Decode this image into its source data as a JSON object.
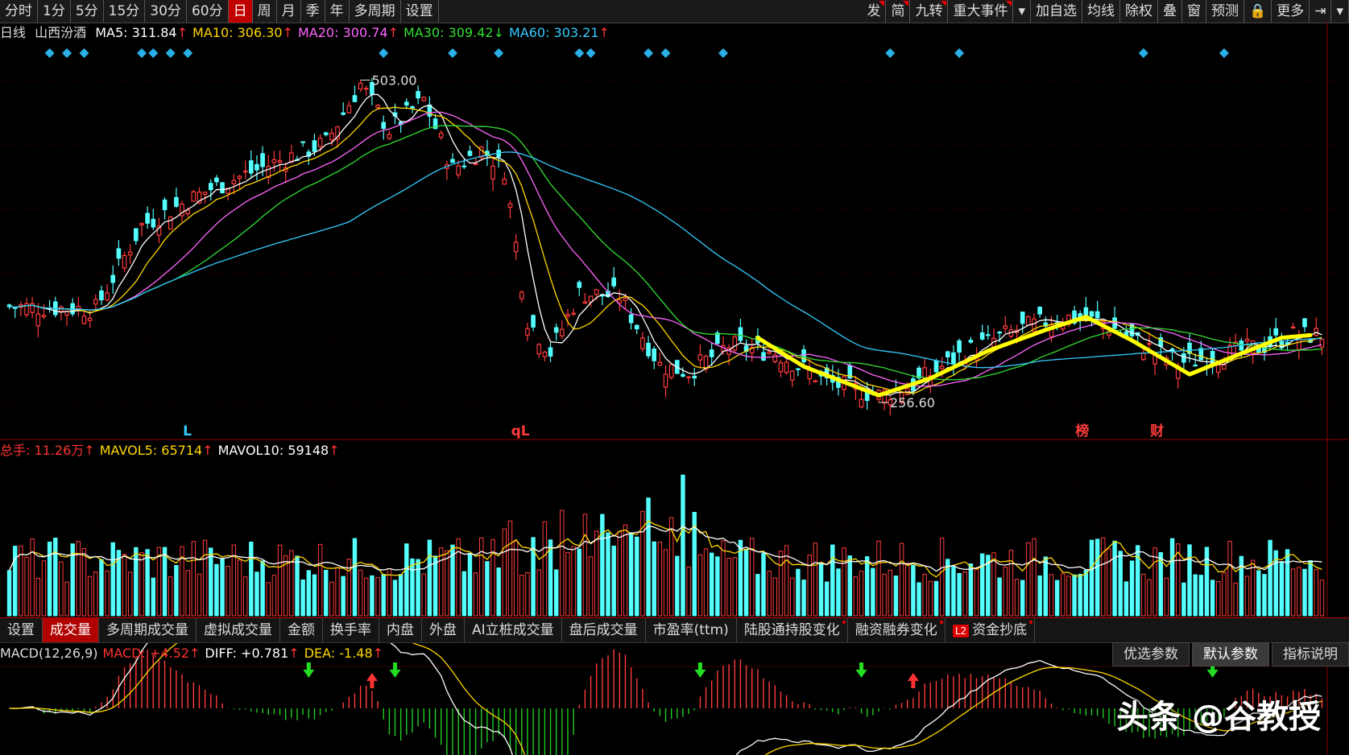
{
  "toolbar": {
    "left": [
      "分时",
      "1分",
      "5分",
      "15分",
      "30分",
      "60分",
      "日",
      "周",
      "月",
      "季",
      "年",
      "多周期",
      "设置"
    ],
    "active": "日",
    "right": [
      {
        "label": "发",
        "dot": true
      },
      {
        "label": "简",
        "dot": true
      },
      {
        "label": "九转",
        "dot": true
      },
      {
        "label": "重大事件",
        "dot": true
      },
      {
        "label": "▾",
        "dot": false
      },
      {
        "label": "加自选",
        "dot": false
      },
      {
        "label": "均线",
        "dot": false
      },
      {
        "label": "除权",
        "dot": false
      },
      {
        "label": "叠",
        "dot": false
      },
      {
        "label": "窗",
        "dot": false
      },
      {
        "label": "预测",
        "dot": false
      },
      {
        "label": "🔒",
        "dot": false
      },
      {
        "label": "更多",
        "dot": false
      },
      {
        "label": "⇥",
        "dot": false
      },
      {
        "label": "▾",
        "dot": false
      }
    ]
  },
  "ma_line": {
    "period": "日线",
    "stock": "山西汾酒",
    "items": [
      {
        "text": "MA5: 311.84",
        "arrow": "↑",
        "color": "#ffffff"
      },
      {
        "text": "MA10: 306.30",
        "arrow": "↑",
        "color": "#ffd700"
      },
      {
        "text": "MA20: 300.74",
        "arrow": "↑",
        "color": "#ff66ff"
      },
      {
        "text": "MA30: 309.42",
        "arrow": "↓",
        "color": "#33dd33"
      },
      {
        "text": "MA60: 303.21",
        "arrow": "↑",
        "color": "#33ccff"
      }
    ]
  },
  "vol_line": {
    "items": [
      {
        "text": "总手: 11.26万",
        "arrow": "↑",
        "color": "#ff3333"
      },
      {
        "text": "MAVOL5: 65714",
        "arrow": "↑",
        "color": "#ffd700"
      },
      {
        "text": "MAVOL10: 59148",
        "arrow": "↑",
        "color": "#ffffff"
      }
    ]
  },
  "macd_line": {
    "items": [
      {
        "text": "MACD(12,26,9)",
        "arrow": "",
        "color": "#dddddd"
      },
      {
        "text": "MACD: +4.52",
        "arrow": "↑",
        "color": "#ff3333"
      },
      {
        "text": "DIFF: +0.781",
        "arrow": "↑",
        "color": "#ffffff"
      },
      {
        "text": "DEA: -1.48",
        "arrow": "↑",
        "color": "#ffd700"
      }
    ]
  },
  "tabs": [
    {
      "label": "设置",
      "active": false,
      "dot": false
    },
    {
      "label": "成交量",
      "active": true,
      "dot": false
    },
    {
      "label": "多周期成交量",
      "active": false,
      "dot": false
    },
    {
      "label": "虚拟成交量",
      "active": false,
      "dot": false
    },
    {
      "label": "金额",
      "active": false,
      "dot": false
    },
    {
      "label": "换手率",
      "active": false,
      "dot": false
    },
    {
      "label": "内盘",
      "active": false,
      "dot": false
    },
    {
      "label": "外盘",
      "active": false,
      "dot": false
    },
    {
      "label": "AI立桩成交量",
      "active": false,
      "dot": false
    },
    {
      "label": "盘后成交量",
      "active": false,
      "dot": false
    },
    {
      "label": "市盈率(ttm)",
      "active": false,
      "dot": false
    },
    {
      "label": "陆股通持股变化",
      "active": false,
      "dot": true
    },
    {
      "label": "融资融券变化",
      "active": false,
      "dot": true
    },
    {
      "label": "资金抄底",
      "active": false,
      "dot": true,
      "badge": "L2"
    }
  ],
  "macd_buttons": [
    {
      "label": "优选参数",
      "active": false
    },
    {
      "label": "默认参数",
      "active": true
    },
    {
      "label": "指标说明",
      "active": false
    }
  ],
  "watermark": "头条 @谷教授",
  "colors": {
    "up": "#ff3b3b",
    "down": "#54ffff",
    "ma5": "#ffffff",
    "ma10": "#ffd700",
    "ma20": "#ff66ff",
    "ma30": "#33dd33",
    "ma60": "#33ccff",
    "hand": "#ffff00"
  },
  "chart_data": {
    "type": "candlestick",
    "price_range": [
      235,
      515
    ],
    "high_label": "503.00",
    "low_label": "256.60",
    "markers": [
      {
        "text": "L",
        "color": "#33ccff",
        "index": 31
      },
      {
        "text": "qL",
        "color": "#ff3b3b",
        "index": 88
      },
      {
        "text": "榜",
        "color": "#ff3b3b",
        "index": 186
      },
      {
        "text": "财",
        "color": "#ff3b3b",
        "index": 199
      }
    ],
    "key_points": [
      {
        "index": 0,
        "price": 330
      },
      {
        "index": 15,
        "price": 328
      },
      {
        "index": 23,
        "price": 392
      },
      {
        "index": 35,
        "price": 420
      },
      {
        "index": 45,
        "price": 438
      },
      {
        "index": 55,
        "price": 455
      },
      {
        "index": 61,
        "price": 500
      },
      {
        "index": 66,
        "price": 465
      },
      {
        "index": 72,
        "price": 488
      },
      {
        "index": 77,
        "price": 435
      },
      {
        "index": 82,
        "price": 450
      },
      {
        "index": 86,
        "price": 435
      },
      {
        "index": 90,
        "price": 320
      },
      {
        "index": 94,
        "price": 295
      },
      {
        "index": 99,
        "price": 340
      },
      {
        "index": 106,
        "price": 338
      },
      {
        "index": 113,
        "price": 285
      },
      {
        "index": 118,
        "price": 280
      },
      {
        "index": 125,
        "price": 300
      },
      {
        "index": 133,
        "price": 295
      },
      {
        "index": 142,
        "price": 272
      },
      {
        "index": 151,
        "price": 262
      },
      {
        "index": 157,
        "price": 270
      },
      {
        "index": 166,
        "price": 295
      },
      {
        "index": 175,
        "price": 312
      },
      {
        "index": 183,
        "price": 322
      },
      {
        "index": 190,
        "price": 318
      },
      {
        "index": 197,
        "price": 300
      },
      {
        "index": 203,
        "price": 287
      },
      {
        "index": 210,
        "price": 292
      },
      {
        "index": 218,
        "price": 300
      },
      {
        "index": 223,
        "price": 308
      }
    ],
    "volume_range": [
      0,
      230000
    ],
    "macd_range": [
      -8,
      8
    ],
    "hand_drawn_line": [
      {
        "index": 130,
        "price": 306
      },
      {
        "index": 138,
        "price": 284
      },
      {
        "index": 151,
        "price": 262
      },
      {
        "index": 160,
        "price": 275
      },
      {
        "index": 170,
        "price": 296
      },
      {
        "index": 180,
        "price": 312
      },
      {
        "index": 187,
        "price": 322
      },
      {
        "index": 195,
        "price": 304
      },
      {
        "index": 205,
        "price": 278
      },
      {
        "index": 214,
        "price": 294
      },
      {
        "index": 221,
        "price": 306
      },
      {
        "index": 226,
        "price": 308
      }
    ]
  }
}
